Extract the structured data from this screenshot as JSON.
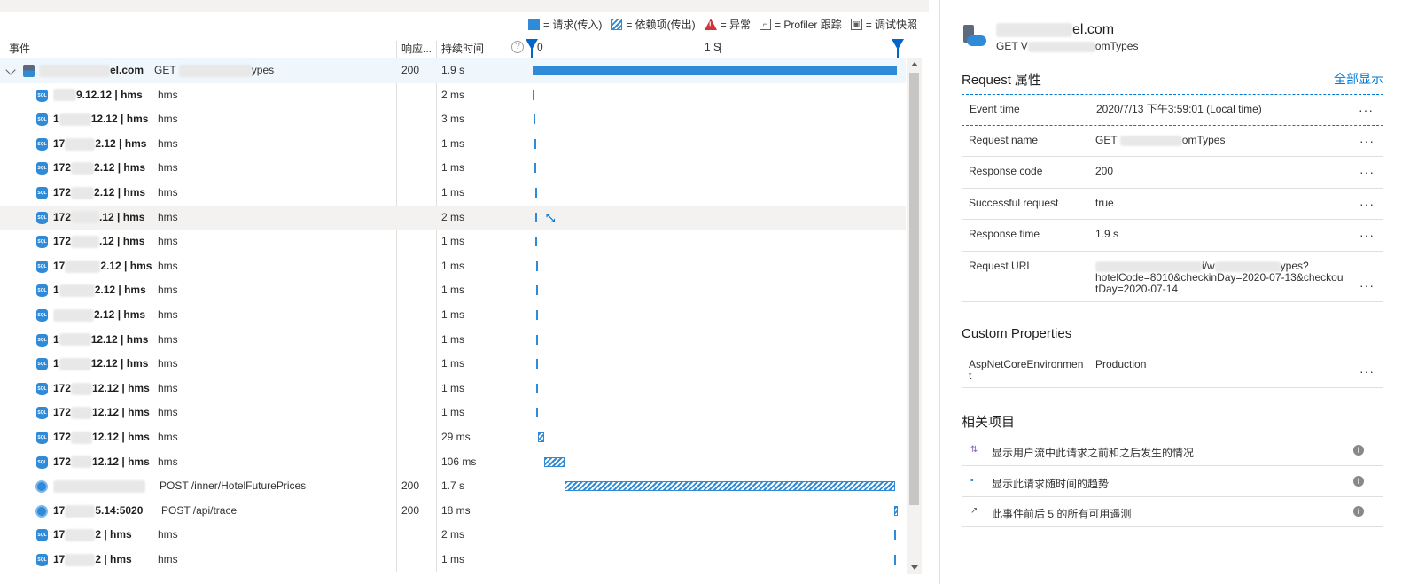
{
  "legend": {
    "request": "= 请求(传入)",
    "dependency": "= 依赖项(传出)",
    "exception": "= 异常",
    "profiler": "= Profiler 跟踪",
    "snapshot": "= 调试快照"
  },
  "columns": {
    "event": "事件",
    "response": "响应...",
    "duration": "持续时间",
    "help": "?",
    "tick_0": "0",
    "tick_1s": "1 S"
  },
  "rows": [
    {
      "name": "el.com",
      "detail": "GET",
      "detail2": "ypes",
      "response": "200",
      "duration": "1.9 s"
    },
    {
      "name": "9.12.12 | hms",
      "detail": "hms",
      "response": "",
      "duration": "2 ms"
    },
    {
      "name": "1",
      "name2": "12.12 | hms",
      "detail": "hms",
      "response": "",
      "duration": "3 ms"
    },
    {
      "name": "17",
      "name2": "2.12 | hms",
      "detail": "hms",
      "response": "",
      "duration": "1 ms"
    },
    {
      "name": "172",
      "name2": "2.12 | hms",
      "detail": "hms",
      "response": "",
      "duration": "1 ms"
    },
    {
      "name": "172",
      "name2": "2.12 | hms",
      "detail": "hms",
      "response": "",
      "duration": "1 ms"
    },
    {
      "name": "172",
      "name2": ".12 | hms",
      "detail": "hms",
      "response": "",
      "duration": "2 ms"
    },
    {
      "name": "172",
      "name2": ".12 | hms",
      "detail": "hms",
      "response": "",
      "duration": "1 ms"
    },
    {
      "name": "17",
      "name2": "2.12 | hms",
      "detail": "hms",
      "response": "",
      "duration": "1 ms"
    },
    {
      "name": "1",
      "name2": "2.12 | hms",
      "detail": "hms",
      "response": "",
      "duration": "1 ms"
    },
    {
      "name": "",
      "name2": "2.12 | hms",
      "detail": "hms",
      "response": "",
      "duration": "1 ms"
    },
    {
      "name": "1",
      "name2": "12.12 | hms",
      "detail": "hms",
      "response": "",
      "duration": "1 ms"
    },
    {
      "name": "1",
      "name2": "12.12 | hms",
      "detail": "hms",
      "response": "",
      "duration": "1 ms"
    },
    {
      "name": "172",
      "name2": "12.12 | hms",
      "detail": "hms",
      "response": "",
      "duration": "1 ms"
    },
    {
      "name": "172",
      "name2": "12.12 | hms",
      "detail": "hms",
      "response": "",
      "duration": "1 ms"
    },
    {
      "name": "172",
      "name2": "12.12 | hms",
      "detail": "hms",
      "response": "",
      "duration": "29 ms"
    },
    {
      "name": "172",
      "name2": "12.12 | hms",
      "detail": "hms",
      "response": "",
      "duration": "106 ms"
    },
    {
      "name": "",
      "name2": "",
      "detail": "POST /inner/HotelFuturePrices",
      "response": "200",
      "duration": "1.7 s"
    },
    {
      "name": "17",
      "name2": "5.14:5020",
      "detail": "POST /api/trace",
      "response": "200",
      "duration": "18 ms"
    },
    {
      "name": "17",
      "name2": "2 | hms",
      "detail": "hms",
      "response": "",
      "duration": "2 ms"
    },
    {
      "name": "17",
      "name2": "2 | hms",
      "detail": "hms",
      "response": "",
      "duration": "1 ms"
    }
  ],
  "panel": {
    "title": "el.com",
    "subtitle_a": "GET V",
    "subtitle_b": "omTypes",
    "request_props_title": "Request 属性",
    "show_all": "全部显示",
    "props": [
      {
        "key": "Event time",
        "value": "2020/7/13 下午3:59:01 (Local time)",
        "more": "···"
      },
      {
        "key": "Request name",
        "value": "GET",
        "value2": "omTypes",
        "more": "···"
      },
      {
        "key": "Response code",
        "value": "200",
        "more": "···"
      },
      {
        "key": "Successful request",
        "value": "true",
        "more": "···"
      },
      {
        "key": "Response time",
        "value": "1.9 s",
        "more": "···"
      },
      {
        "key": "Request URL",
        "value_a": "i/w",
        "value_b": "ypes?",
        "value": "hotelCode=8010&checkinDay=2020-07-13&checkoutDay=2020-07-14",
        "more": "···"
      }
    ],
    "custom_title": "Custom Properties",
    "custom": [
      {
        "key": "AspNetCoreEnvironment",
        "value": "Production",
        "more": "···"
      }
    ],
    "related_title": "相关项目",
    "related": [
      {
        "icon": "flow-icon",
        "glyph": "⇅",
        "text": "显示用户流中此请求之前和之后发生的情况",
        "info": "i"
      },
      {
        "icon": "chart-icon",
        "glyph": "▪",
        "text": "显示此请求随时间的趋势",
        "info": "i"
      },
      {
        "icon": "arrow-icon",
        "glyph": "↗",
        "text": "此事件前后 5 的所有可用遥测",
        "info": "i"
      }
    ]
  }
}
